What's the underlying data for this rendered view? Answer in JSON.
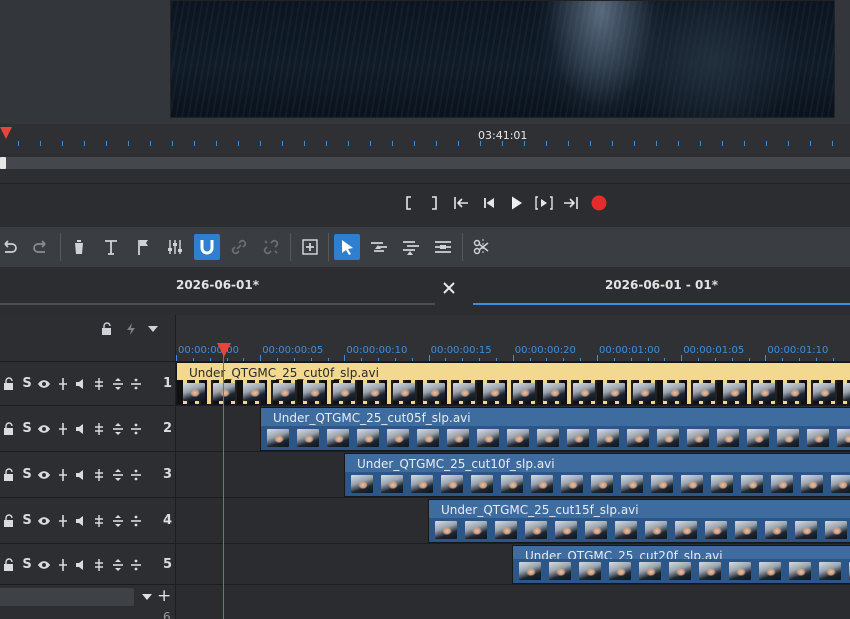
{
  "preview": {
    "timecode": "03:41:01"
  },
  "transport": {
    "icons": [
      "mark-in-icon",
      "mark-out-icon",
      "go-to-start-icon",
      "prev-frame-icon",
      "play-icon",
      "next-frame-icon",
      "go-to-end-icon",
      "record-icon"
    ],
    "record_color": "#e52b2b"
  },
  "toolbar": {
    "icons": [
      "undo-icon",
      "redo-icon",
      "delete-icon",
      "title-icon",
      "marker-flag-icon",
      "mixer-icon",
      "magnet-icon",
      "link-icon",
      "unlink-icon",
      "insert-icon",
      "pointer-icon",
      "ripple-edit-icon",
      "ripple-all-icon",
      "slip-icon",
      "razor-icon"
    ],
    "active": [
      "magnet-icon",
      "pointer-icon"
    ],
    "accent": "#2f7fd0"
  },
  "tabs": {
    "left_label": "2026-06-01*",
    "right_label": "2026-06-01 - 01*",
    "close_glyph": "×"
  },
  "track_header": {
    "solo_label": "S",
    "tracks": [
      {
        "number": "1"
      },
      {
        "number": "2"
      },
      {
        "number": "3"
      },
      {
        "number": "4"
      },
      {
        "number": "5"
      }
    ],
    "add_glyph": "+",
    "partial_track_number": "6"
  },
  "timeline": {
    "ruler_labels": [
      "00:00:00:00",
      "00:00:00:05",
      "00:00:00:10",
      "00:00:00:15",
      "00:00:00:20",
      "00:00:01:00",
      "00:00:01:05",
      "00:00:01:10"
    ],
    "clips": [
      {
        "name": "Under_QTGMC_25_cut0f_slp.avi",
        "color": "#f5d98c"
      },
      {
        "name": "Under_QTGMC_25_cut05f_slp.avi",
        "color": "#3d6a9e"
      },
      {
        "name": "Under_QTGMC_25_cut10f_slp.avi",
        "color": "#3d6a9e"
      },
      {
        "name": "Under_QTGMC_25_cut15f_slp.avi",
        "color": "#3d6a9e"
      },
      {
        "name": "Under_QTGMC_25_cut20f_slp.avi",
        "color": "#3d6a9e"
      }
    ],
    "playhead_color": "#e8443a"
  }
}
